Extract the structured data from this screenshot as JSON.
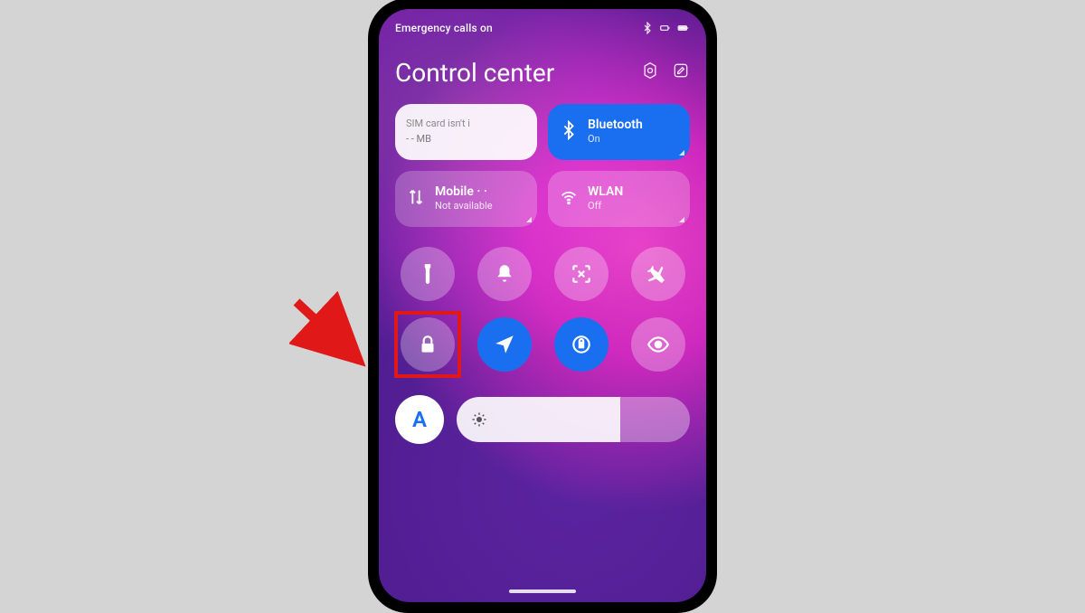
{
  "status": {
    "left_text": "Emergency calls on"
  },
  "header": {
    "title": "Control center"
  },
  "tiles": {
    "sim": {
      "line1": "SIM card isn't i",
      "line2": "- - MB"
    },
    "bluetooth": {
      "label": "Bluetooth",
      "status": "On"
    },
    "mobile": {
      "label": "Mobile · ·",
      "status": "Not available"
    },
    "wlan": {
      "label": "WLAN",
      "status": "Off"
    }
  },
  "bottom": {
    "auto_label": "A",
    "brightness_pct": 64
  }
}
